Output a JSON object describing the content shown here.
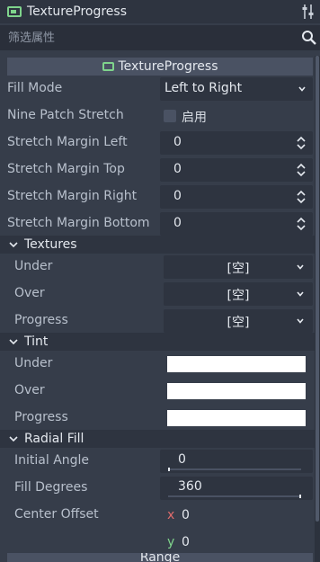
{
  "colors": {
    "background": "#363d4a",
    "titlebar": "#2e3440",
    "field": "#2e3440",
    "section_header": "#2e3440",
    "class_header": "#4a5263",
    "label_text": "#b8c0cc",
    "value_text": "#e4e8ee",
    "accent_green": "#7fd48c",
    "axis_x": "#e06c6c",
    "axis_y": "#7fd48c"
  },
  "header": {
    "title": "TextureProgress",
    "node_icon": "textureprogress-node-icon",
    "tools_icon": "object-properties-icon"
  },
  "filter": {
    "placeholder": "筛选属性",
    "icon": "search-icon"
  },
  "class_section": {
    "label": "TextureProgress"
  },
  "props": {
    "fill_mode": {
      "label": "Fill Mode",
      "value": "Left to Right"
    },
    "nine_patch": {
      "label": "Nine Patch Stretch",
      "value": "启用",
      "checked": false
    },
    "margin_left": {
      "label": "Stretch Margin Left",
      "value": "0"
    },
    "margin_top": {
      "label": "Stretch Margin Top",
      "value": "0"
    },
    "margin_right": {
      "label": "Stretch Margin Right",
      "value": "0"
    },
    "margin_bottom": {
      "label": "Stretch Margin Bottom",
      "value": "0"
    }
  },
  "textures": {
    "title": "Textures",
    "under": {
      "label": "Under",
      "value": "[空]"
    },
    "over": {
      "label": "Over",
      "value": "[空]"
    },
    "progress": {
      "label": "Progress",
      "value": "[空]"
    }
  },
  "tint": {
    "title": "Tint",
    "under": {
      "label": "Under",
      "color": "#ffffff"
    },
    "over": {
      "label": "Over",
      "color": "#ffffff"
    },
    "progress": {
      "label": "Progress",
      "color": "#ffffff"
    }
  },
  "radial": {
    "title": "Radial Fill",
    "initial_angle": {
      "label": "Initial Angle",
      "value": "0",
      "fraction": 0.0
    },
    "fill_degrees": {
      "label": "Fill Degrees",
      "value": "360",
      "fraction": 1.0
    },
    "center_offset": {
      "label": "Center Offset",
      "x_label": "x",
      "x": "0",
      "y_label": "y",
      "y": "0"
    }
  },
  "next_section": {
    "label": "Range"
  }
}
